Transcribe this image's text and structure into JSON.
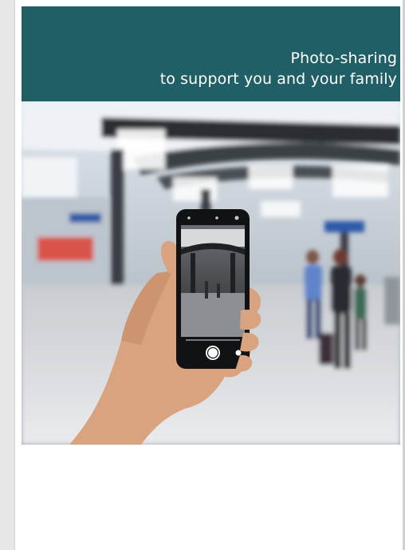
{
  "document": {
    "banner": {
      "line1": "Photo-sharing",
      "line2": "to support you and your family",
      "background": "#215f66",
      "text_color": "#ffffff"
    },
    "photo": {
      "icon": "photo-image"
    }
  }
}
